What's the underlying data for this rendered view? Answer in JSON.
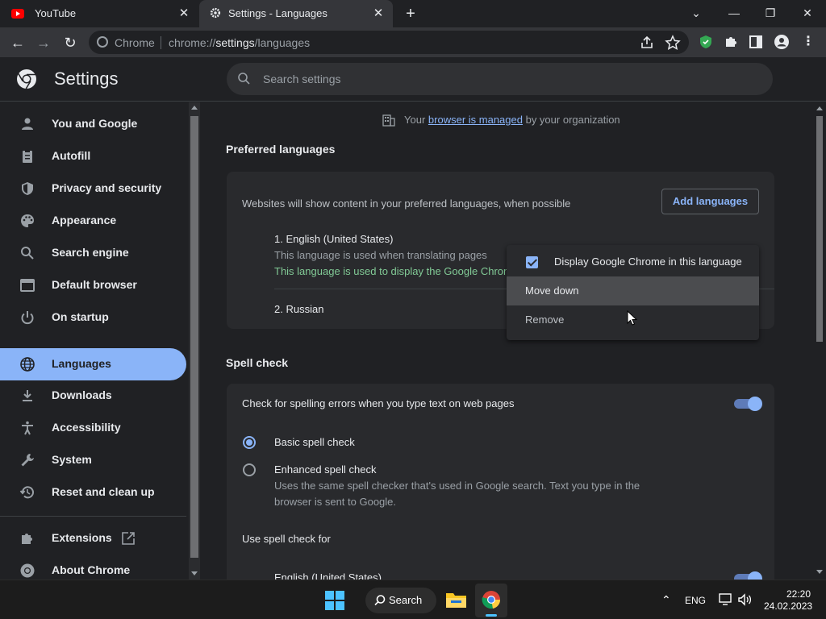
{
  "tabs": [
    {
      "title": "YouTube",
      "icon": "youtube-icon",
      "close": "✕"
    },
    {
      "title": "Settings - Languages",
      "icon": "gear-icon",
      "close": "✕"
    }
  ],
  "new_tab": "+",
  "window_controls": {
    "tab_search": "⌄",
    "minimize": "—",
    "restore": "❐",
    "close": "✕"
  },
  "toolbar": {
    "back": "←",
    "forward": "→",
    "reload": "↻",
    "origin_chip": "Chrome",
    "url_prefix": "chrome://",
    "url_host": "settings",
    "url_path": "/languages"
  },
  "settings": {
    "title": "Settings",
    "search_placeholder": "Search settings"
  },
  "sidebar": {
    "items": [
      {
        "label": "You and Google",
        "icon": "person-icon"
      },
      {
        "label": "Autofill",
        "icon": "clipboard-icon"
      },
      {
        "label": "Privacy and security",
        "icon": "shield-icon"
      },
      {
        "label": "Appearance",
        "icon": "palette-icon"
      },
      {
        "label": "Search engine",
        "icon": "search-icon"
      },
      {
        "label": "Default browser",
        "icon": "browser-window-icon"
      },
      {
        "label": "On startup",
        "icon": "power-icon"
      },
      {
        "label": "Languages",
        "icon": "globe-icon",
        "selected": true
      },
      {
        "label": "Downloads",
        "icon": "download-icon"
      },
      {
        "label": "Accessibility",
        "icon": "accessibility-icon"
      },
      {
        "label": "System",
        "icon": "wrench-icon"
      },
      {
        "label": "Reset and clean up",
        "icon": "history-icon"
      },
      {
        "label": "Extensions",
        "icon": "puzzle-icon"
      },
      {
        "label": "About Chrome",
        "icon": "chrome-icon"
      }
    ]
  },
  "managed": {
    "prefix": "Your",
    "link": "browser is managed",
    "suffix": "by your organization"
  },
  "preferred_languages": {
    "title": "Preferred languages",
    "description": "Websites will show content in your preferred languages, when possible",
    "add_button": "Add languages",
    "languages": [
      {
        "name": "1. English (United States)",
        "note1": "This language is used when translating pages",
        "note2": "This language is used to display the Google Chrom"
      },
      {
        "name": "2. Russian"
      }
    ]
  },
  "context_menu": {
    "display_in_language": "Display Google Chrome in this language",
    "move_down": "Move down",
    "remove": "Remove"
  },
  "spell_check": {
    "title": "Spell check",
    "check_label": "Check for spelling errors when you type text on web pages",
    "basic": "Basic spell check",
    "enhanced": "Enhanced spell check",
    "enhanced_desc_1": "Uses the same spell checker that's used in Google search. Text you type in the",
    "enhanced_desc_2": "browser is sent to Google.",
    "use_for": "Use spell check for",
    "language": "English (United States)"
  },
  "taskbar": {
    "search": "Search",
    "lang": "ENG",
    "time": "22:20",
    "date": "24.02.2023"
  },
  "colors": {
    "accent": "#8ab4f8",
    "success": "#81c995",
    "background": "#202124",
    "card": "#292a2d"
  }
}
